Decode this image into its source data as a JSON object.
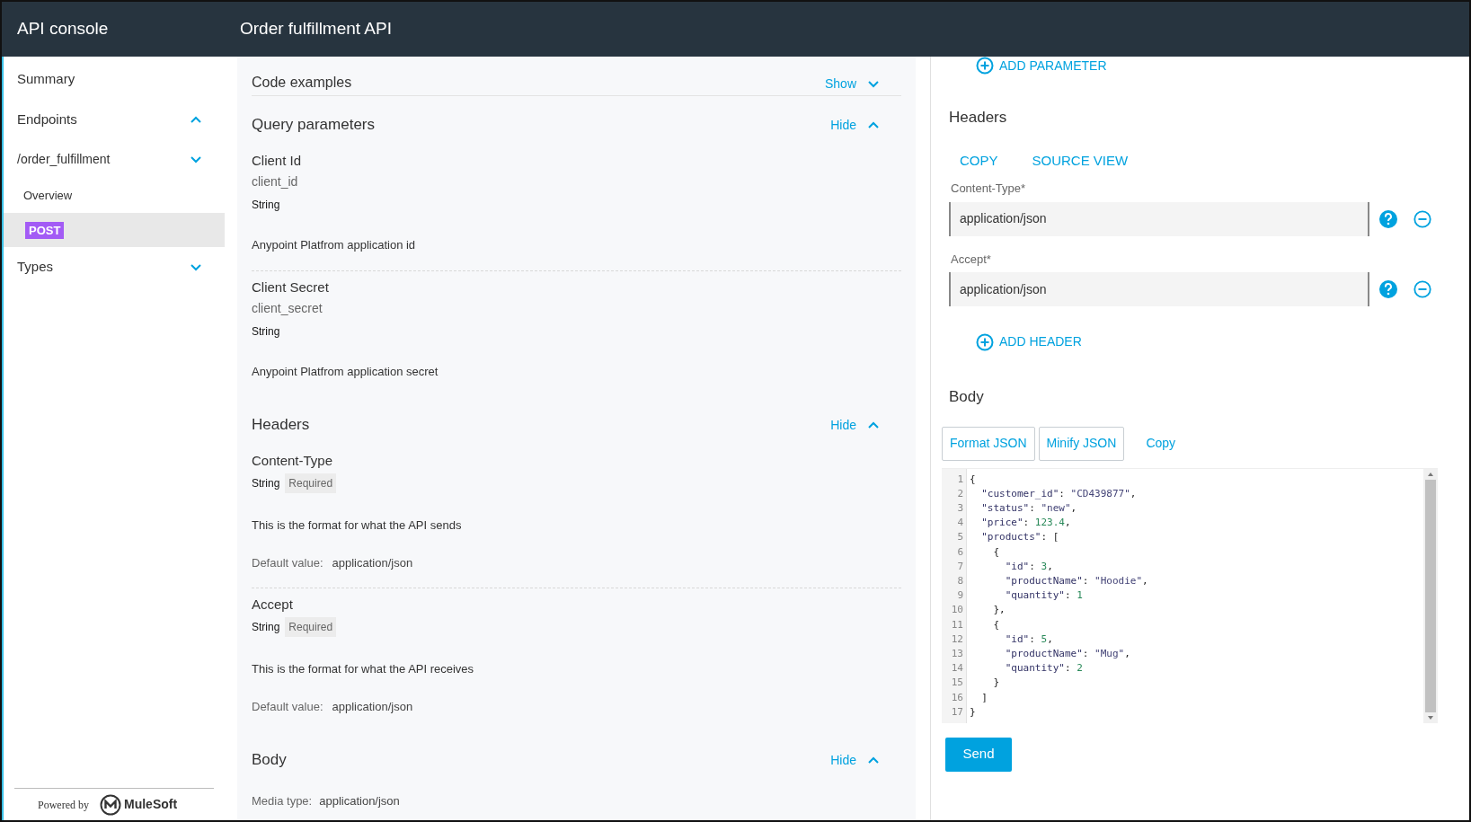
{
  "header": {
    "app_title": "API console",
    "page_title": "Order fulfillment API"
  },
  "sidebar": {
    "items": [
      {
        "label": "Summary",
        "kind": "link",
        "selected": false
      },
      {
        "label": "Endpoints",
        "kind": "group",
        "expanded": true,
        "selected": false
      },
      {
        "label": "/order_fulfillment",
        "kind": "group",
        "expanded": false,
        "selected": false
      },
      {
        "label": "Overview",
        "kind": "sub",
        "selected": false
      },
      {
        "label": "POST",
        "kind": "method",
        "selected": true
      },
      {
        "label": "Types",
        "kind": "group",
        "expanded": false,
        "selected": false
      }
    ],
    "footer": {
      "powered_by": "Powered by",
      "brand": "MuleSoft"
    }
  },
  "docs": {
    "sections": [
      {
        "title": "Code examples",
        "toggle": "Show",
        "expanded": false
      },
      {
        "title": "Query parameters",
        "toggle": "Hide",
        "expanded": true,
        "params": [
          {
            "name": "Client Id",
            "key": "client_id",
            "type": "String",
            "description": "Anypoint Platfrom application id"
          },
          {
            "name": "Client Secret",
            "key": "client_secret",
            "type": "String",
            "description": "Anypoint Platfrom application secret"
          }
        ]
      },
      {
        "title": "Headers",
        "toggle": "Hide",
        "expanded": true,
        "params": [
          {
            "name": "Content-Type",
            "type": "String",
            "badge": "Required",
            "description": "This is the format for what the API sends",
            "default_label": "Default value:",
            "default_value": "application/json"
          },
          {
            "name": "Accept",
            "type": "String",
            "badge": "Required",
            "description": "This is the format for what the API receives",
            "default_label": "Default value:",
            "default_value": "application/json"
          }
        ]
      },
      {
        "title": "Body",
        "toggle": "Hide",
        "expanded": true,
        "media_label": "Media type:",
        "media_value": "application/json"
      }
    ]
  },
  "request": {
    "add_parameter": "ADD PARAMETER",
    "headers": {
      "title": "Headers",
      "actions": [
        "COPY",
        "SOURCE VIEW"
      ],
      "fields": [
        {
          "label": "Content-Type*",
          "value": "application/json"
        },
        {
          "label": "Accept*",
          "value": "application/json"
        }
      ],
      "add": "ADD HEADER"
    },
    "body": {
      "title": "Body",
      "buttons": [
        {
          "label": "Format JSON",
          "kind": "outlined"
        },
        {
          "label": "Minify JSON",
          "kind": "outlined"
        },
        {
          "label": "Copy",
          "kind": "text"
        }
      ],
      "code_lines": [
        {
          "n": "1",
          "text": "{"
        },
        {
          "n": "2",
          "text": "  \"customer_id\": \"CD439877\","
        },
        {
          "n": "3",
          "text": "  \"status\": \"new\","
        },
        {
          "n": "4",
          "text": "  \"price\": 123.4,"
        },
        {
          "n": "5",
          "text": "  \"products\": ["
        },
        {
          "n": "6",
          "text": "    {"
        },
        {
          "n": "7",
          "text": "      \"id\": 3,"
        },
        {
          "n": "8",
          "text": "      \"productName\": \"Hoodie\","
        },
        {
          "n": "9",
          "text": "      \"quantity\": 1"
        },
        {
          "n": "10",
          "text": "    },"
        },
        {
          "n": "11",
          "text": "    {"
        },
        {
          "n": "12",
          "text": "      \"id\": 5,"
        },
        {
          "n": "13",
          "text": "      \"productName\": \"Mug\","
        },
        {
          "n": "14",
          "text": "      \"quantity\": 2"
        },
        {
          "n": "15",
          "text": "    }"
        },
        {
          "n": "16",
          "text": "  ]"
        },
        {
          "n": "17",
          "text": "}"
        }
      ]
    },
    "send": "Send"
  }
}
